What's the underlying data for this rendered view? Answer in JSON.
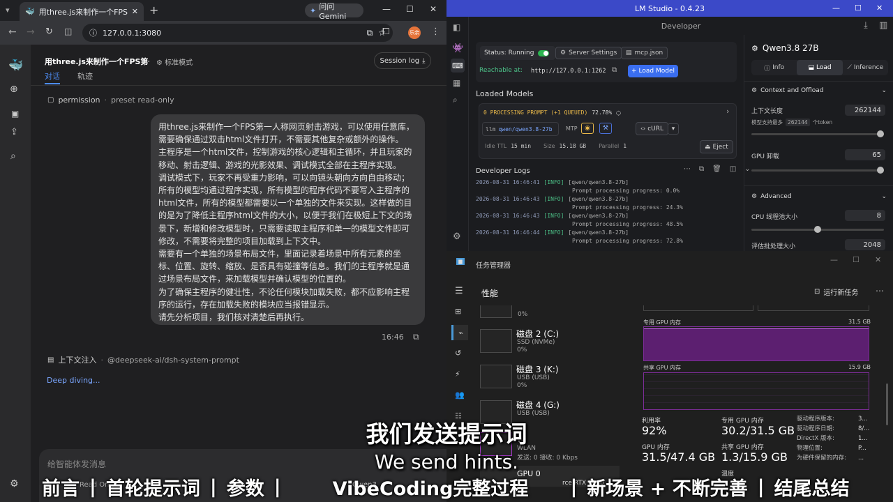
{
  "browser": {
    "tab_title": "用three.js来制作一个FPS第一人",
    "gemini_button": "问问 Gemini",
    "url": "127.0.0.1:3080",
    "profile_initials": "乐余"
  },
  "chat": {
    "title": "用three.js来制作一个FPS第一人",
    "mode": "标准模式",
    "session_log": "Session log",
    "tabs": [
      "对话",
      "轨迹"
    ],
    "permission_label": "permission",
    "permission_preset": "preset read-only",
    "message_paragraphs": [
      "用three.js来制作一个FPS第一人称网页射击游戏，可以使用任意库，需要确保通过双击html文件打开，不需要其他复杂或额外的操作。",
      "主程序是一个html文件，控制游戏的核心逻辑和主循环，并且玩家的移动、射击逻辑、游戏的光影效果、调试模式全部在主程序实现。",
      "调试模式下，玩家不再受重力影响，可以向镜头朝向方向自由移动；所有的模型均通过程序实现，所有模型的程序代码不要写入主程序的html文件，所有的模型都需要以一个单独的文件来实现。这样做的目的是为了降低主程序html文件的大小，以便于我们在极短上下文的场景下，新增和修改模型时，只需要读取主程序和单一的模型文件即可修改，不需要将完整的项目加载到上下文中。",
      "需要有一个单独的场景布局文件，里面记录着场景中所有元素的坐标、位置、旋转、缩放、是否具有碰撞等信息。我们的主程序就是通过场景布局文件，来加载模型并确认模型的位置的。",
      "为了确保主程序的健壮性，不论任何模块加载失败，都不应影响主程序的运行，存在加载失败的模块应当报错显示。",
      "请先分析项目，我们核对清楚后再执行。"
    ],
    "message_time": "16:46",
    "context_inject_label": "上下文注入",
    "context_inject_value": "@deepseek-ai/dsh-system-prompt",
    "status": "Deep diving...",
    "input_placeholder": "给智能体发消息",
    "read_only_label": "Read Only",
    "model_label": "Qwen3"
  },
  "lm": {
    "title": "LM Studio - 0.4.23",
    "header": "Developer",
    "status_label": "Status: Running",
    "server_settings": "Server Settings",
    "mcp": "mcp.json",
    "reachable_label": "Reachable at:",
    "reachable_url": "http://127.0.0.1:1262",
    "load_model": "Load Model",
    "loaded_models": "Loaded Models",
    "processing": "0 PROCESSING PROMPT (+1 QUEUED)",
    "processing_pct": "72.78%",
    "model_id_prefix": "llm",
    "model_id": "qwen/qwen3.8-27b",
    "mtp": "MTP",
    "curl": "cURL",
    "idle_ttl_label": "Idle TTL",
    "idle_ttl": "15 min",
    "size_label": "Size",
    "size": "15.18 GB",
    "parallel_label": "Parallel",
    "parallel": "1",
    "eject": "Eject",
    "dev_logs": "Developer Logs",
    "logs": [
      {
        "ts": "2026-08-31 16:46:41",
        "tag": "[INFO]",
        "msg": "[qwen/qwen3.8-27b]",
        "cont": "Prompt processing progress: 0.0%"
      },
      {
        "ts": "2026-08-31 16:46:43",
        "tag": "[INFO]",
        "msg": "[qwen/qwen3.8-27b]",
        "cont": "Prompt processing progress: 24.3%"
      },
      {
        "ts": "2026-08-31 16:46:43",
        "tag": "[INFO]",
        "msg": "[qwen/qwen3.8-27b]",
        "cont": "Prompt processing progress: 48.5%"
      },
      {
        "ts": "2026-08-31 16:46:44",
        "tag": "[INFO]",
        "msg": "[qwen/qwen3.8-27b]",
        "cont": "Prompt processing progress: 72.8%"
      }
    ],
    "panel_model": "Qwen3.8 27B",
    "panel_tabs": [
      "Info",
      "Load",
      "Inference"
    ],
    "context_offload": "Context and Offload",
    "ctx_len_label": "上下文长度",
    "ctx_len": "262144",
    "ctx_max_prefix": "模型支持最多",
    "ctx_max": "262144",
    "ctx_max_suffix": "个token",
    "gpu_offload_label": "GPU 卸载",
    "gpu_offload": "65",
    "advanced": "Advanced",
    "cpu_threads_label": "CPU 线程池大小",
    "cpu_threads": "8",
    "batch_label": "评估批处理大小",
    "batch": "2048",
    "ctx_slider": 1.0,
    "gpu_slider": 1.0,
    "cpu_slider": 0.5,
    "accent": "#3b49c8"
  },
  "tm": {
    "title": "任务管理器",
    "section": "性能",
    "run_new": "运行新任务",
    "disks": [
      {
        "name": "",
        "type": "",
        "pct": "0%"
      },
      {
        "name": "磁盘 2 (C:)",
        "type": "SSD (NVMe)",
        "pct": "0%"
      },
      {
        "name": "磁盘 3 (K:)",
        "type": "USB (USB)",
        "pct": "0%"
      },
      {
        "name": "磁盘 4 (G:)",
        "type": "USB (USB)",
        "pct": ""
      }
    ],
    "wifi": "Wi",
    "wlan": "WLAN",
    "wlan_rate": "发送: 0 接收: 0 Kbps",
    "gpu_item": "GPU 0",
    "gpu_model": "rce RTX 5090",
    "ded_mem_label": "专用 GPU 内存",
    "ded_mem_max": "31.5 GB",
    "shared_mem_label": "共享 GPU 内存",
    "shared_mem_max": "15.9 GB",
    "util_label": "利用率",
    "util": "92%",
    "ded_label": "专用 GPU 内存",
    "ded": "30.2/31.5 GB",
    "gpu_mem_label": "GPU 内存",
    "gpu_mem": "31.5/47.4 GB",
    "shared_label": "共享 GPU 内存",
    "shared": "1.3/15.9 GB",
    "driver_labels": [
      "驱动程序版本:",
      "驱动程序日期:",
      "DirectX 版本:",
      "物理位置:",
      "为硬件保留的内存:"
    ],
    "driver_values": [
      "3...",
      "8/...",
      "1...",
      "P...",
      "..."
    ],
    "temp_label": "温度",
    "ded_fill": 0.96,
    "graph_color": "#a43ac6"
  },
  "overlay": {
    "subtitle_zh": "我们发送提示词",
    "subtitle_en": "We send hints.",
    "chapters": [
      "前言",
      "首轮提示词",
      "参数",
      "VibeCoding完整过程",
      "新场景 + 不断完善",
      "结尾总结"
    ]
  }
}
